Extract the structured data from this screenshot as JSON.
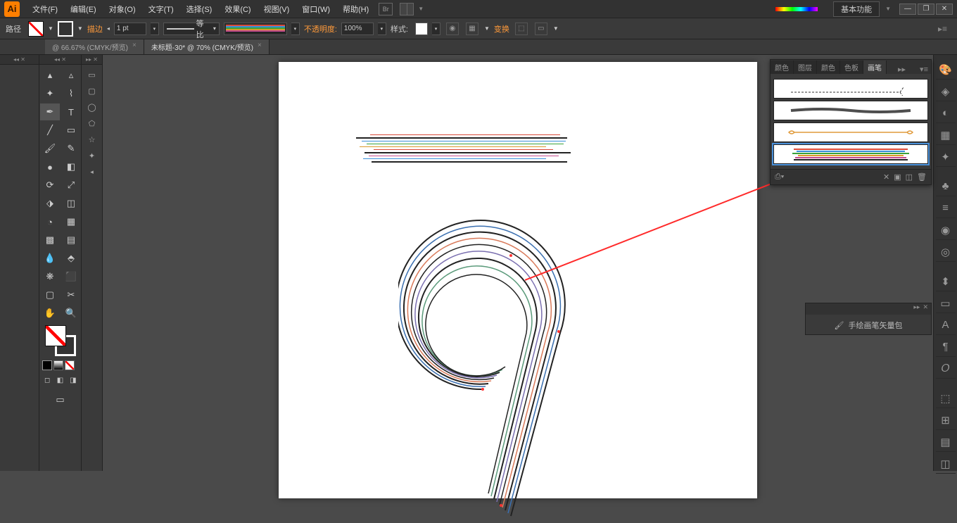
{
  "menubar": {
    "items": [
      "文件(F)",
      "编辑(E)",
      "对象(O)",
      "文字(T)",
      "选择(S)",
      "效果(C)",
      "视图(V)",
      "窗口(W)",
      "帮助(H)"
    ],
    "workspace": "基本功能"
  },
  "controlbar": {
    "label": "路径",
    "stroke_label": "描边",
    "stroke_weight": "1 pt",
    "profile_label": "等比",
    "opacity_label": "不透明度:",
    "opacity_value": "100%",
    "style_label": "样式:",
    "transform_label": "变换"
  },
  "tabs": [
    {
      "label": "@ 66.67% (CMYK/预览)",
      "active": false
    },
    {
      "label": "未标题-30* @ 70% (CMYK/预览)",
      "active": true
    }
  ],
  "brush_panel": {
    "tabs": [
      "颜色",
      "图层",
      "颜色",
      "色板",
      "画笔"
    ],
    "active_tab": 4
  },
  "library_panel": {
    "title": "手绘画笔矢量包"
  },
  "artwork": {
    "rainbow_line_colors": [
      "#d94b3a",
      "#222",
      "#3a8fd9",
      "#3aa23a",
      "#d99a2a",
      "#d94b3a",
      "#222",
      "#c44b8f",
      "#3a8fd9",
      "#222"
    ],
    "rainbow_line_offsets": [
      20,
      0,
      8,
      15,
      5,
      25,
      12,
      18,
      10,
      22
    ]
  }
}
